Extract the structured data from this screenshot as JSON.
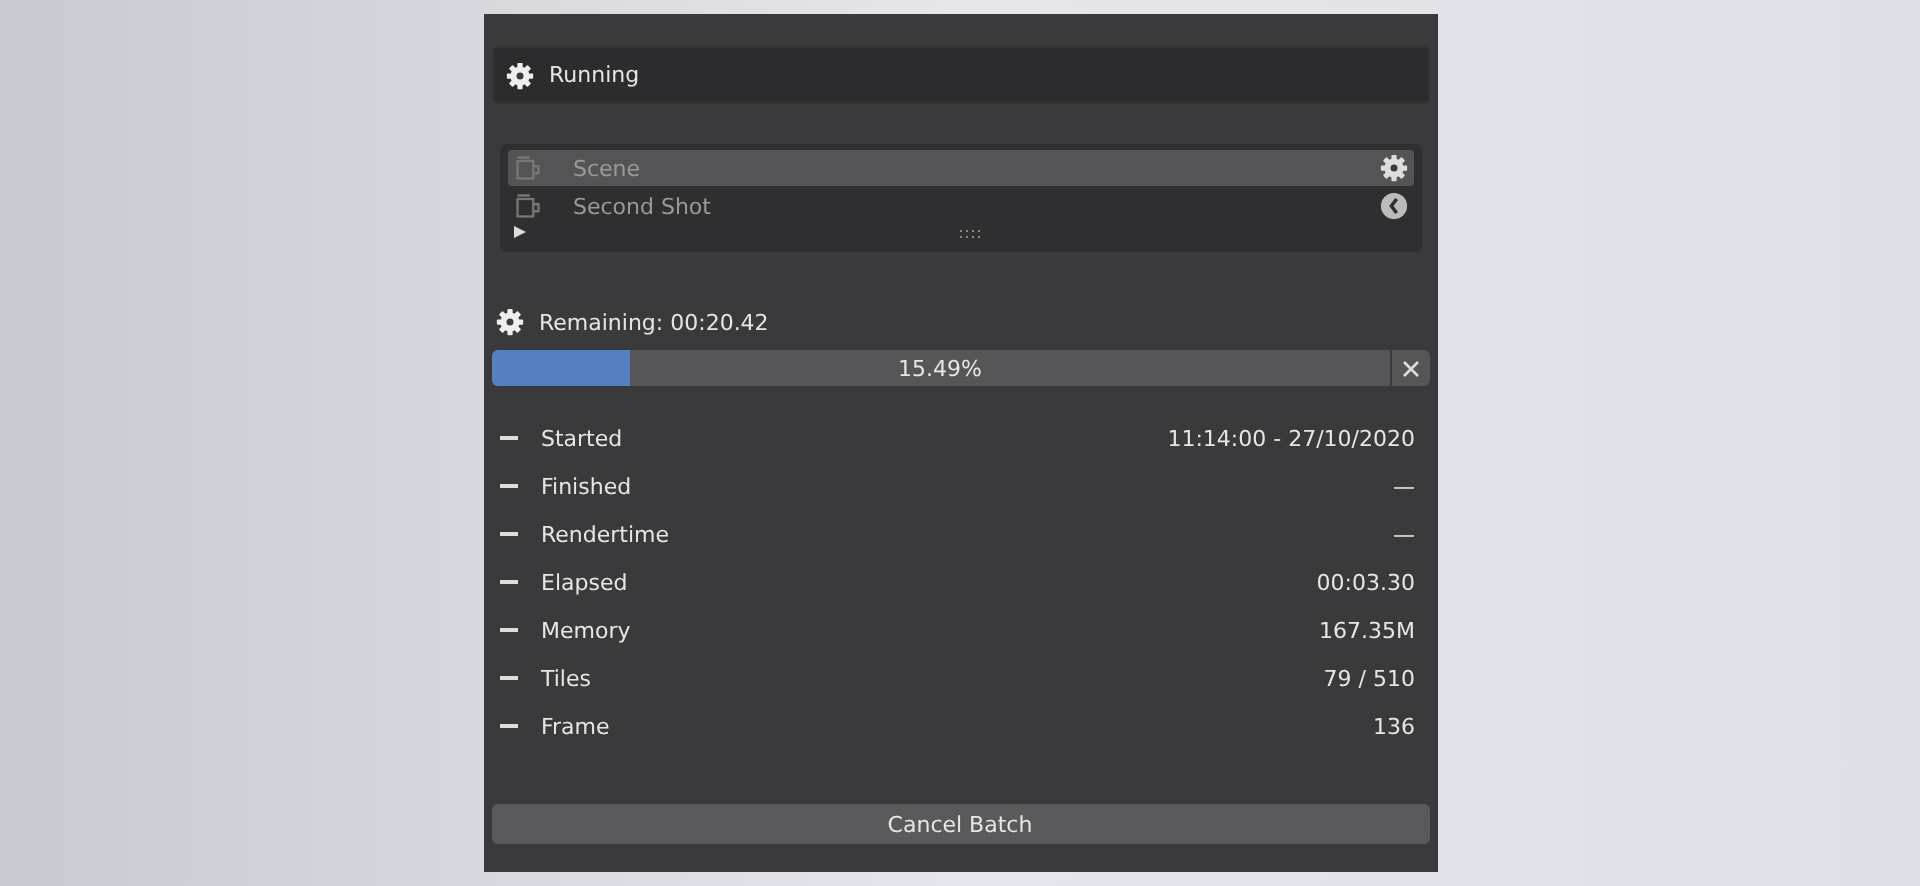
{
  "status": {
    "label": "Running"
  },
  "shots": [
    {
      "name": "Scene",
      "selected": true,
      "kind": "rendering"
    },
    {
      "name": "Second Shot",
      "selected": false,
      "kind": "queued"
    }
  ],
  "remaining": {
    "label": "Remaining: 00:20.42"
  },
  "progress": {
    "level": 0.1549,
    "reading": "15.49%"
  },
  "stats": [
    {
      "label": "Started",
      "value": "11:14:00 - 27/10/2020"
    },
    {
      "label": "Finished",
      "value": "—"
    },
    {
      "label": "Rendertime",
      "value": "—"
    },
    {
      "label": "Elapsed",
      "value": "00:03.30"
    },
    {
      "label": "Memory",
      "value": "167.35M"
    },
    {
      "label": "Tiles",
      "value": "79 / 510"
    },
    {
      "label": "Frame",
      "value": "136"
    }
  ],
  "cancel_button": {
    "label": "Cancel Batch"
  }
}
